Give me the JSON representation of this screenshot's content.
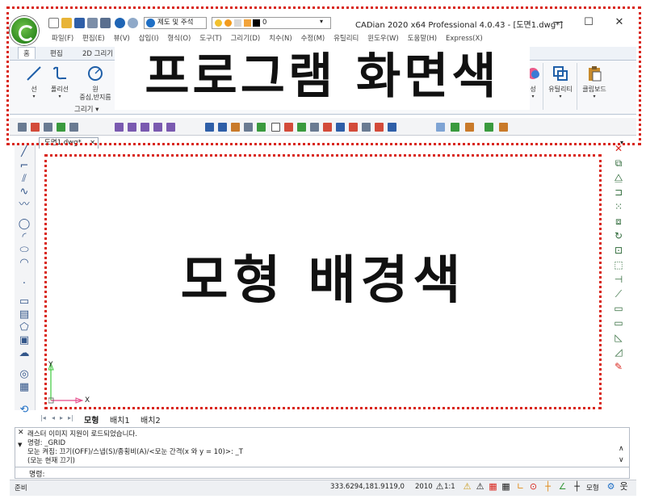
{
  "window": {
    "title": "CADian 2020 x64 Professional 4.0.43 - [도면1.dwg*]",
    "minimize": "—",
    "maximize": "☐",
    "close": "✕"
  },
  "quick_access": {
    "workspace": "제도 및 주석",
    "layer": "0"
  },
  "menu": [
    "파일(F)",
    "편집(E)",
    "뷰(V)",
    "삽입(I)",
    "형식(O)",
    "도구(T)",
    "그리기(D)",
    "치수(N)",
    "수정(M)",
    "유틸리티",
    "윈도우(W)",
    "도움말(H)",
    "Express(X)"
  ],
  "ribbon": {
    "tabs": [
      "홈",
      "편집",
      "2D 그리기"
    ],
    "tools": {
      "line": "선",
      "polyline": "폴리선",
      "circle": "원",
      "circle_sub": "중심,반지름",
      "property": "성",
      "utility": "유틸리티",
      "clipboard": "클립보드"
    },
    "group_draw": "그리기"
  },
  "overlay": {
    "program_color": "프로그램 화면색",
    "model_color": "모형 배경색"
  },
  "document_tab": {
    "name": "도면1.dwg*",
    "close": "✕"
  },
  "ucs": {
    "x": "X",
    "y": "Y"
  },
  "layout_tabs": [
    "모형",
    "배치1",
    "배치2"
  ],
  "command": {
    "lines": [
      "래스터 이미지 지원이 로드되었습니다.",
      "명령: _GRID",
      "모눈 켜짐: 끄기(OFF)/스냅(S)/종횡비(A)/<모눈 간격(x 와 y = 10)>: _T",
      "(모눈 현재 끄기)"
    ],
    "prompt": "명령:"
  },
  "status": {
    "ready": "준비",
    "coords": "333.6294,181.9119,0",
    "year": "2010",
    "scale": "1:1",
    "model": "모형"
  },
  "colors": {
    "highlight_frame": "#d9251c",
    "logo": "#2f8a1f"
  }
}
